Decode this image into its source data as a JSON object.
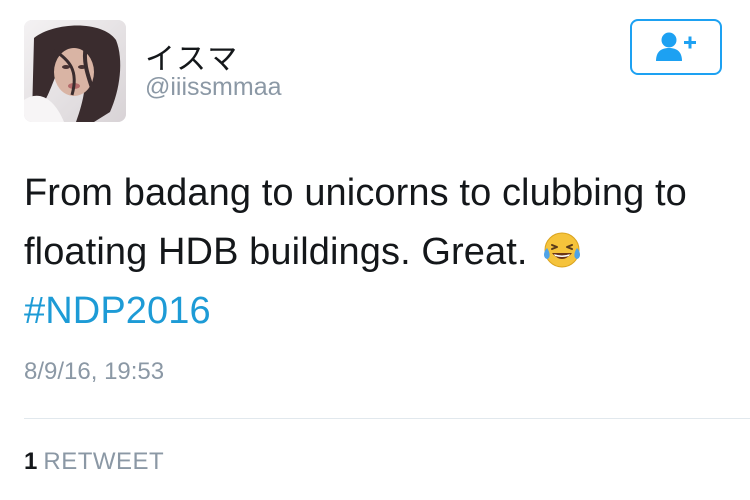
{
  "user": {
    "display_name": "イスマ",
    "handle": "@iiissmmaa",
    "avatar_icon": "profile-photo"
  },
  "follow_button": {
    "icon": "add-user-icon",
    "color": "#1da1f2"
  },
  "tweet": {
    "line1": "From badang to unicorns to clubbing to",
    "line2": "floating HDB buildings. Great.",
    "emoji": "face-with-tears-of-joy-emoji",
    "hashtag": "#NDP2016",
    "hashtag_color": "#1d9bd6",
    "timestamp": "8/9/16, 19:53"
  },
  "stats": {
    "retweet_count": "1",
    "retweet_label": "RETWEET"
  }
}
